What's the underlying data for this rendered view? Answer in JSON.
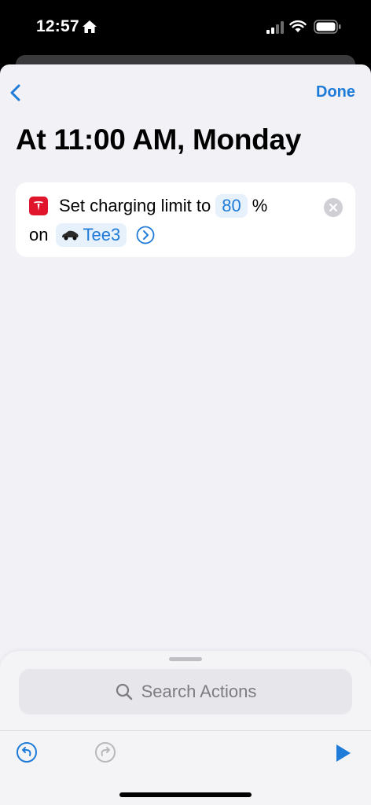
{
  "status": {
    "time": "12:57"
  },
  "nav": {
    "done_label": "Done"
  },
  "title": "At 11:00 AM, Monday",
  "action": {
    "text_prefix": "Set charging limit to",
    "limit_value": "80",
    "unit": "%",
    "on_label": "on",
    "vehicle": "Tee3"
  },
  "search": {
    "placeholder": "Search Actions"
  },
  "colors": {
    "accent": "#1f7bd8",
    "tesla_red": "#e0142a",
    "background": "#f1f1f6"
  },
  "icons": [
    "back-chevron-icon",
    "tesla-logo-icon",
    "car-icon",
    "chevron-right-circle-icon",
    "close-circle-icon",
    "search-icon",
    "undo-icon",
    "redo-icon",
    "play-icon"
  ]
}
